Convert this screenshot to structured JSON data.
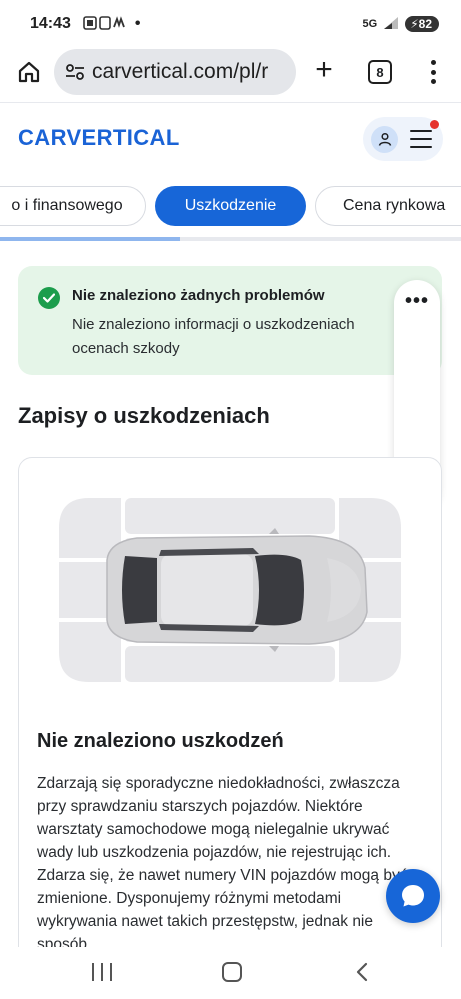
{
  "status_bar": {
    "time": "14:43",
    "indicator_extra": "•",
    "network": "5G",
    "battery": "82"
  },
  "browser": {
    "url": "carvertical.com/pl/r",
    "tab_count": "8"
  },
  "site": {
    "logo": "CARVERTICAL"
  },
  "tabs": [
    {
      "label": "o i finansowego",
      "active": false
    },
    {
      "label": "Uszkodzenie",
      "active": true
    },
    {
      "label": "Cena rynkowa",
      "active": false
    }
  ],
  "tabs_scroll_progress_percent": 39,
  "alert": {
    "title": "Nie znaleziono żadnych problemów",
    "body": "Nie znaleziono informacji o uszkodzeniach ocenach szkody"
  },
  "section": {
    "title": "Zapisy o uszkodzeniach"
  },
  "card": {
    "title": "Nie znaleziono uszkodzeń",
    "body": "Zdarzają się sporadyczne niedokładności, zwłaszcza przy sprawdzaniu starszych pojazdów. Niektóre warsztaty samochodowe mogą nielegalnie ukrywać wady lub uszkodzenia pojazdów, nie rejestrując ich. Zdarza się, że nawet numery VIN pojazdów mogą być zmienione. Dysponujemy różnymi metodami wykrywania nawet takich przestępstw, jednak nie sposób"
  },
  "colors": {
    "brand_blue": "#1766d8",
    "success_bg": "#e5f5e8",
    "success_icon": "#1c9d4c",
    "notification": "#e5322d"
  },
  "icons": {
    "home": "home-icon",
    "site_info": "tune-icon",
    "new_tab": "plus-icon",
    "menu": "more-vert-icon",
    "user": "user-icon",
    "hamburger": "hamburger-icon",
    "check": "check-circle-icon",
    "float_menu": "more-horiz-icon",
    "audio": "audio-icon",
    "chat": "chat-icon"
  }
}
